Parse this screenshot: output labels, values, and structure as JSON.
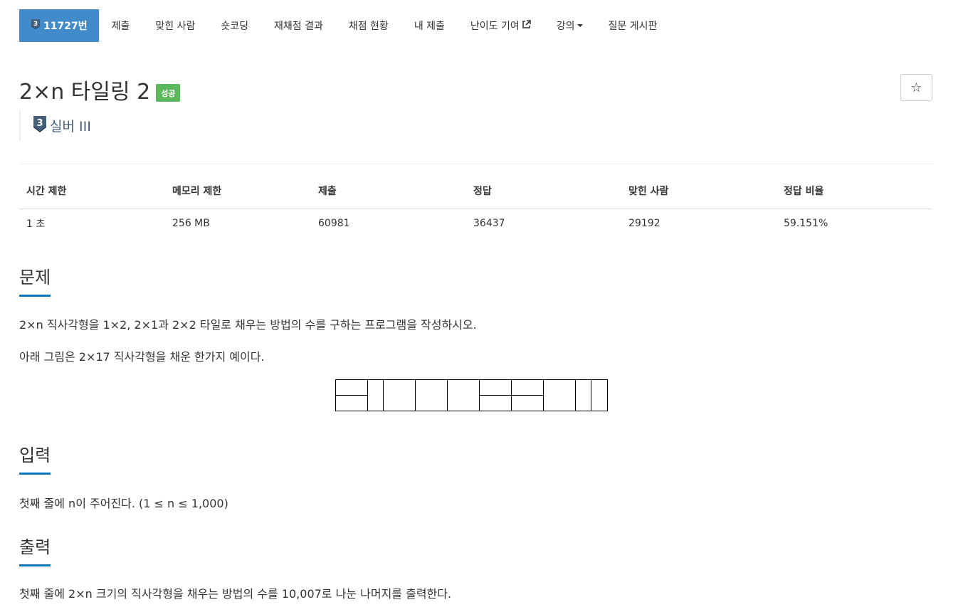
{
  "nav": {
    "problem_id": "11727번",
    "tier_number": "3",
    "items": [
      "제출",
      "맞힌 사람",
      "숏코딩",
      "재채점 결과",
      "채점 현황",
      "내 제출",
      "난이도 기여",
      "강의",
      "질문 게시판"
    ]
  },
  "problem": {
    "title": "2×n 타일링 2",
    "status_badge": "성공",
    "star": "☆",
    "tier_number": "3",
    "tier_label": "실버 III"
  },
  "info_table": {
    "headers": [
      "시간 제한",
      "메모리 제한",
      "제출",
      "정답",
      "맞힌 사람",
      "정답 비율"
    ],
    "values": [
      "1 초",
      "256 MB",
      "60981",
      "36437",
      "29192",
      "59.151%"
    ]
  },
  "sections": {
    "description": {
      "heading": "문제",
      "p1": "2×n 직사각형을 1×2, 2×1과 2×2 타일로 채우는 방법의 수를 구하는 프로그램을 작성하시오.",
      "p2": "아래 그림은 2×17 직사각형을 채운 한가지 예이다."
    },
    "input": {
      "heading": "입력",
      "p1": "첫째 줄에 n이 주어진다. (1 ≤ n ≤ 1,000)"
    },
    "output": {
      "heading": "출력",
      "p1": "첫째 줄에 2×n 크기의 직사각형을 채우는 방법의 수를 10,007로 나눈 나머지를 출력한다."
    }
  },
  "colors": {
    "nav_active": "#428bca",
    "success_badge": "#5cb85c",
    "tier_silver": "#435f7a",
    "section_underline": "#0076c0"
  },
  "icons": {
    "tier": "silver-tier-icon",
    "external_link": "external-link-icon",
    "caret": "caret-down-icon",
    "star": "star-icon"
  }
}
